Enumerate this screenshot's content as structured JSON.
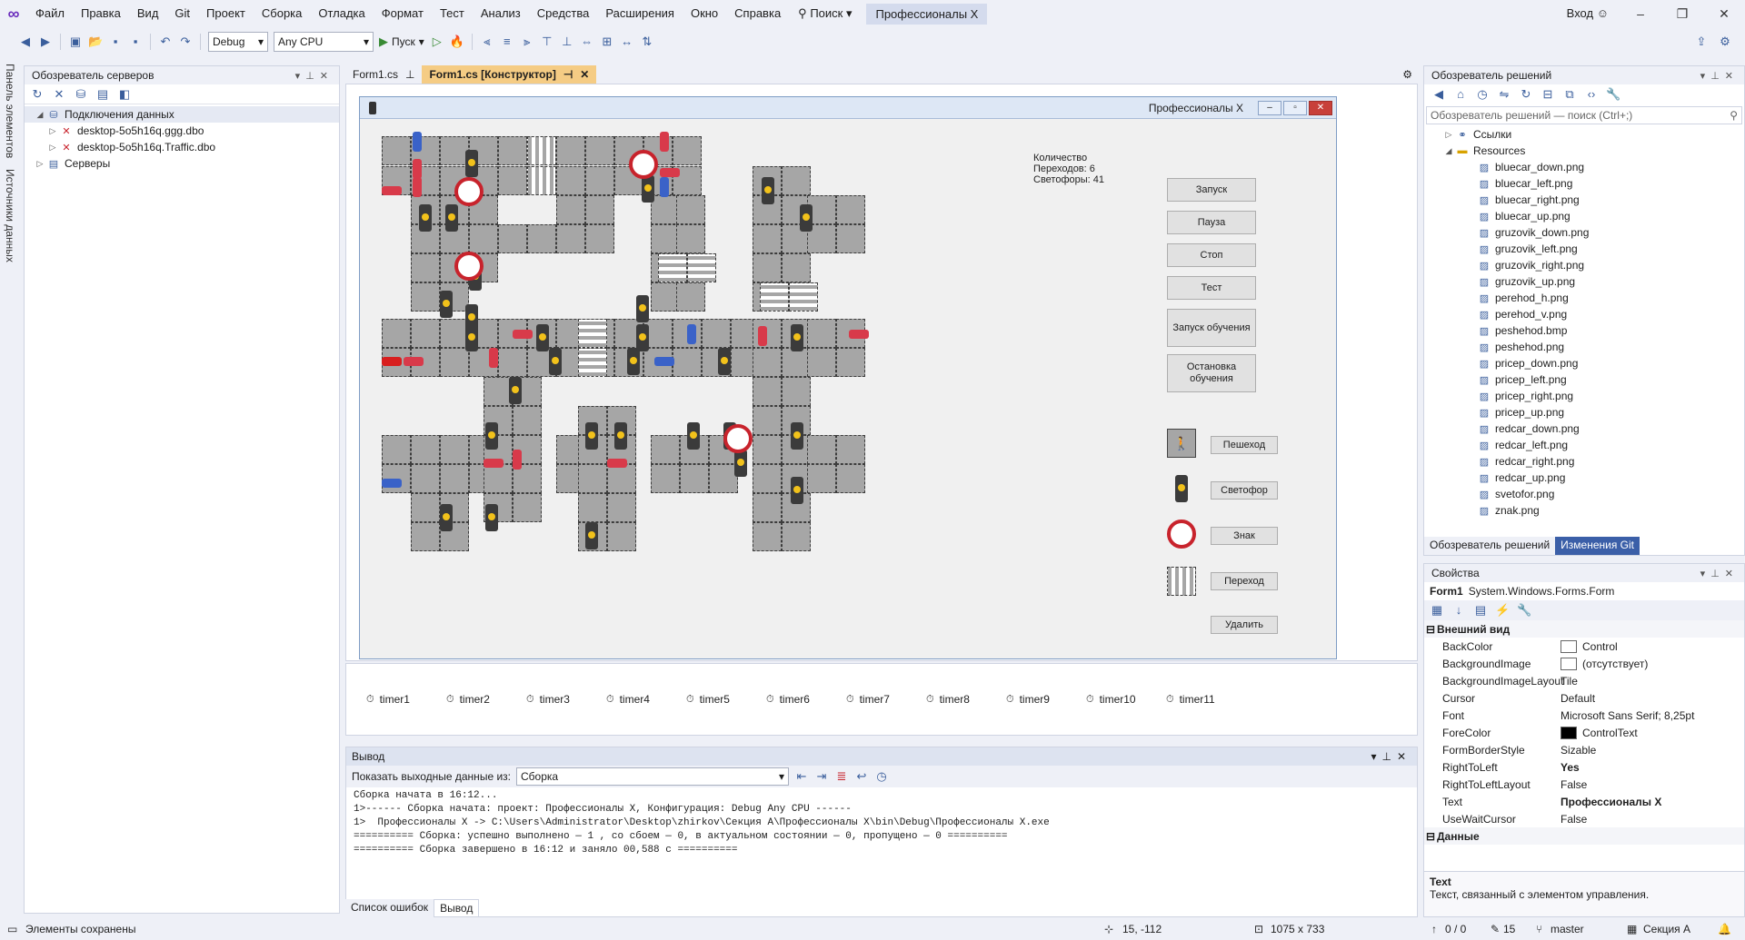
{
  "menu": {
    "items": [
      "Файл",
      "Правка",
      "Вид",
      "Git",
      "Проект",
      "Сборка",
      "Отладка",
      "Формат",
      "Тест",
      "Анализ",
      "Средства",
      "Расширения",
      "Окно",
      "Справка"
    ],
    "search": "Поиск",
    "active_project": "Профессионалы X",
    "signin": "Вход"
  },
  "toolbar": {
    "config": "Debug",
    "platform": "Any CPU",
    "start": "Пуск"
  },
  "left_tabs": [
    "Панель элементов",
    "Источники данных"
  ],
  "server_explorer": {
    "title": "Обозреватель серверов",
    "items": [
      {
        "label": "Подключения данных",
        "level": 1
      },
      {
        "label": "desktop-5o5h16q.ggg.dbo",
        "level": 2
      },
      {
        "label": "desktop-5o5h16q.Traffic.dbo",
        "level": 2
      },
      {
        "label": "Серверы",
        "level": 1
      }
    ]
  },
  "editor_tabs": [
    {
      "label": "Form1.cs"
    },
    {
      "label": "Form1.cs [Конструктор]"
    }
  ],
  "form": {
    "title": "Профессионалы X",
    "info_title": "Количество",
    "info_crossings": "Переходов: 6",
    "info_lights": "Светофоры: 41",
    "buttons": [
      "Запуск",
      "Пауза",
      "Стоп",
      "Тест",
      "Запуск обучения",
      "Остановка обучения"
    ],
    "palette": [
      "Пешеход",
      "Светофор",
      "Знак",
      "Переход",
      "Удалить"
    ]
  },
  "timers": [
    "timer1",
    "timer2",
    "timer3",
    "timer4",
    "timer5",
    "timer6",
    "timer7",
    "timer8",
    "timer9",
    "timer10",
    "timer11"
  ],
  "output": {
    "title": "Вывод",
    "show_label": "Показать выходные данные из:",
    "source": "Сборка",
    "lines": [
      "Сборка начата в 16:12...",
      "1>------ Сборка начата: проект: Профессионалы X, Конфигурация: Debug Any CPU ------",
      "1>  Профессионалы X -> C:\\Users\\Administrator\\Desktop\\zhirkov\\Секция A\\Профессионалы X\\bin\\Debug\\Профессионалы X.exe",
      "========== Сборка: успешно выполнено — 1 , со сбоем — 0, в актуальном состоянии — 0, пропущено — 0 ==========",
      "========== Сборка завершено в 16:12 и заняло 00,588 с =========="
    ],
    "tabs": [
      "Список ошибок",
      "Вывод"
    ]
  },
  "solution": {
    "title": "Обозреватель решений",
    "search": "Обозреватель решений — поиск (Ctrl+;)",
    "items": [
      "Ссылки",
      "Resources",
      "bluecar_down.png",
      "bluecar_left.png",
      "bluecar_right.png",
      "bluecar_up.png",
      "gruzovik_down.png",
      "gruzovik_left.png",
      "gruzovik_right.png",
      "gruzovik_up.png",
      "perehod_h.png",
      "perehod_v.png",
      "peshehod.bmp",
      "peshehod.png",
      "pricep_down.png",
      "pricep_left.png",
      "pricep_right.png",
      "pricep_up.png",
      "redcar_down.png",
      "redcar_left.png",
      "redcar_right.png",
      "redcar_up.png",
      "svetofor.png",
      "znak.png"
    ],
    "tabs": [
      "Обозреватель решений",
      "Изменения Git"
    ]
  },
  "properties": {
    "title": "Свойства",
    "object": "Form1",
    "type": "System.Windows.Forms.Form",
    "category1": "Внешний вид",
    "rows": [
      {
        "k": "BackColor",
        "v": "Control",
        "swatch": "#ffffff"
      },
      {
        "k": "BackgroundImage",
        "v": "(отсутствует)",
        "swatch": "#ffffff"
      },
      {
        "k": "BackgroundImageLayout",
        "v": "Tile"
      },
      {
        "k": "Cursor",
        "v": "Default"
      },
      {
        "k": "Font",
        "v": "Microsoft Sans Serif; 8,25pt"
      },
      {
        "k": "ForeColor",
        "v": "ControlText",
        "swatch": "#000000"
      },
      {
        "k": "FormBorderStyle",
        "v": "Sizable"
      },
      {
        "k": "RightToLeft",
        "v": "Yes",
        "bold": true
      },
      {
        "k": "RightToLeftLayout",
        "v": "False"
      },
      {
        "k": "Text",
        "v": "Профессионалы X",
        "bold": true
      },
      {
        "k": "UseWaitCursor",
        "v": "False"
      }
    ],
    "category2": "Данные",
    "desc_title": "Text",
    "desc": "Текст, связанный с элементом управления."
  },
  "status": {
    "left": "Элементы сохранены",
    "pos": "15, -112",
    "size": "1075 x 733",
    "errors": "0 / 0",
    "changes": "15",
    "branch": "master",
    "section": "Секция A"
  },
  "colors": {
    "accent": "#3b5fa8",
    "tab_active": "#f5cc84"
  }
}
